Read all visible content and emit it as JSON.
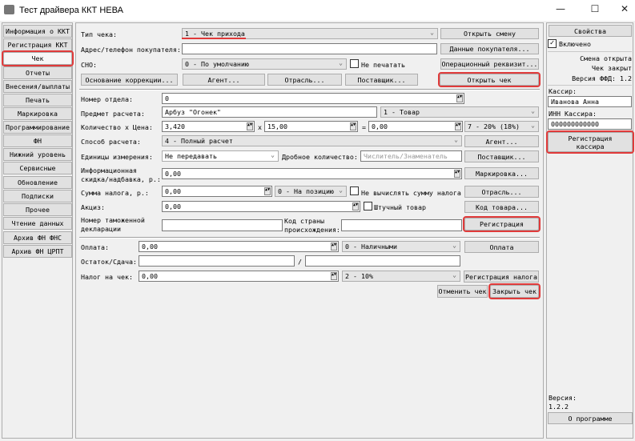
{
  "window": {
    "title": "Тест драйвера ККТ НЕВА",
    "min": "—",
    "max": "☐",
    "close": "✕"
  },
  "sidebar": [
    "Информация о ККТ",
    "Регистрация ККТ",
    "Чек",
    "Отчеты",
    "Внесения/выплаты",
    "Печать",
    "Маркировка",
    "Программирование",
    "ФН",
    "Нижний уровень",
    "Сервисные",
    "Обновление",
    "Подписки",
    "Прочее",
    "Чтение данных",
    "Архив ФН ФНС",
    "Архив ФН ЦРПТ"
  ],
  "receipt": {
    "type_label": "Тип чека:",
    "type_value": "1 - Чек прихода",
    "open_shift": "Открыть смену",
    "buyer_label": "Адрес/телефон покупателя:",
    "buyer_value": "",
    "buyer_data": "Данные покупателя...",
    "sno_label": "СНО:",
    "sno_value": "0 - По умолчанию",
    "no_print": "Не печатать",
    "op_attr": "Операционный реквизит...",
    "correction": "Основание коррекции...",
    "agent": "Агент...",
    "industry": "Отрасль...",
    "supplier": "Поставщик...",
    "open_receipt": "Открыть чек"
  },
  "item": {
    "dept_label": "Номер отдела:",
    "dept_value": "0",
    "subject_label": "Предмет расчета:",
    "subject_value": "Арбуз \"Огонек\"",
    "subject_type": "1 - Товар",
    "qty_label": "Количество х Цена:",
    "qty": "3,420",
    "x": "x",
    "price": "15,00",
    "eq": "=",
    "sum": "0,00",
    "vat": "7 - 20% (18%)",
    "method_label": "Способ расчета:",
    "method_value": "4 - Полный расчет",
    "agent": "Агент...",
    "units_label": "Единицы измерения:",
    "units_value": "Не передавать",
    "fraction_label": "Дробное количество:",
    "fraction_placeholder": "Числитель/Знаменатель",
    "supplier": "Поставщик...",
    "discount_label1": "Информационная",
    "discount_label2": "скидка/надбавка, р.:",
    "discount_value": "0,00",
    "marking": "Маркировка...",
    "tax_label": "Сумма налога, р.:",
    "tax_value": "0,00",
    "tax_mode": "0 - На позицию",
    "no_calc_tax": "Не вычислять сумму налога",
    "industry": "Отрасль...",
    "excise_label": "Акциз:",
    "excise_value": "0,00",
    "piece": "Штучный товар",
    "product_code": "Код товара...",
    "customs_label1": "Номер таможенной",
    "customs_label2": "декларации",
    "customs_value": "",
    "country_label1": "Код страны",
    "country_label2": "происхождения:",
    "country_value": "",
    "register": "Регистрация"
  },
  "payment": {
    "pay_label": "Оплата:",
    "pay_value": "0,00",
    "pay_type": "0 - Наличными",
    "pay_btn": "Оплата",
    "change_label": "Остаток/Сдача:",
    "change1": "",
    "slash": "/",
    "change2": "",
    "tax_label": "Налог на чек:",
    "tax_value": "0,00",
    "tax_type": "2 - 10%",
    "tax_btn": "Регистрация налога",
    "cancel": "Отменить чек",
    "close": "Закрыть чек"
  },
  "right": {
    "properties": "Свойства",
    "enabled": "Включено",
    "shift": "Смена открыта",
    "receipt": "Чек закрыт",
    "ffd": "Версия ФФД: 1.2",
    "cashier_label": "Кассир:",
    "cashier": "Иванова Анна",
    "inn_label": "ИНН Кассира:",
    "inn": "000000000000",
    "reg_cashier1": "Регистрация",
    "reg_cashier2": "кассира",
    "version_label": "Версия:",
    "version": "1.2.2",
    "about": "О программе"
  }
}
